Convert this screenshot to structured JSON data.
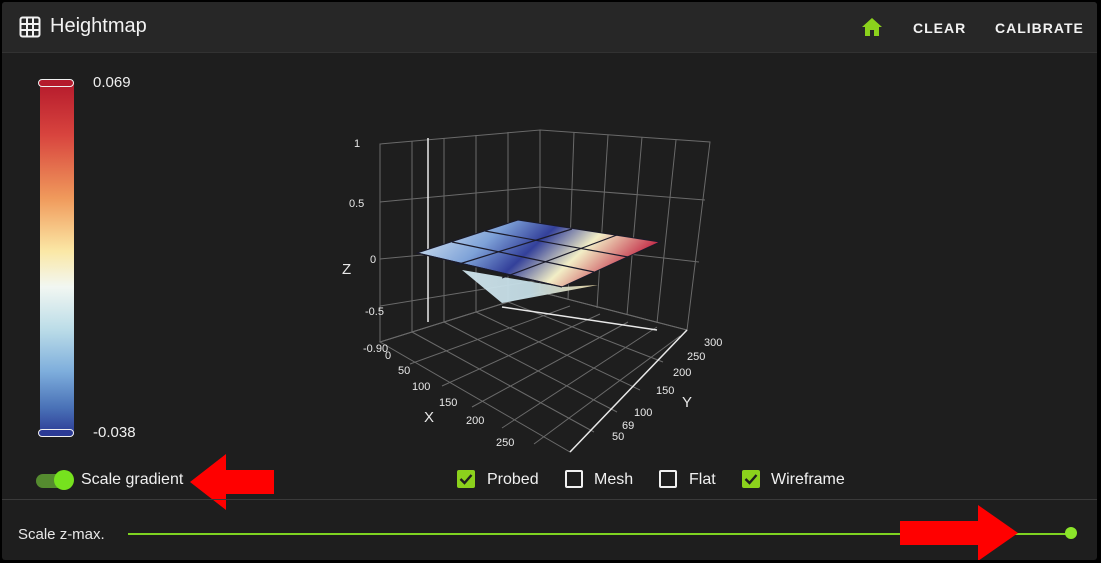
{
  "header": {
    "title": "Heightmap",
    "grid_icon": "grid-icon",
    "home_icon": "home-icon",
    "clear_label": "CLEAR",
    "calibrate_label": "CALIBRATE"
  },
  "legend": {
    "max": "0.069",
    "min": "-0.038"
  },
  "plot": {
    "z_axis_label": "Z",
    "x_axis_label": "X",
    "y_axis_label": "Y",
    "z_ticks": [
      "1",
      "0.5",
      "0",
      "-0.5",
      "-0.90",
      "0"
    ],
    "x_ticks": [
      "50",
      "100",
      "150",
      "200",
      "250"
    ],
    "y_ticks": [
      "50",
      "69",
      "100",
      "150",
      "200",
      "250",
      "300"
    ]
  },
  "options": {
    "scale_gradient_label": "Scale gradient",
    "scale_gradient_on": true,
    "checkboxes": [
      {
        "label": "Probed",
        "checked": true
      },
      {
        "label": "Mesh",
        "checked": false
      },
      {
        "label": "Flat",
        "checked": false
      },
      {
        "label": "Wireframe",
        "checked": true
      }
    ]
  },
  "slider": {
    "label": "Scale z-max.",
    "value_fraction": 1.0
  },
  "colors": {
    "accent": "#8bd11c",
    "annotation_arrow": "#ff0000",
    "background": "#1e1e1e"
  }
}
